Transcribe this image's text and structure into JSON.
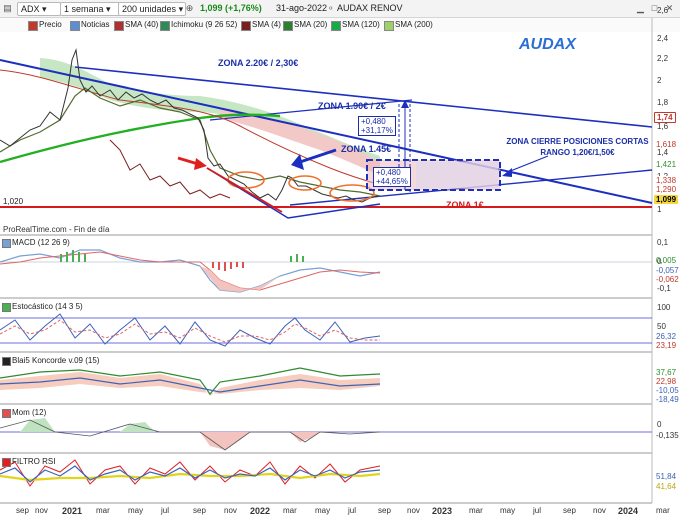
{
  "toolbar": {
    "symbol": "ADX",
    "timeframe": "1 semana",
    "units": "200 unidades",
    "price_change": "1,099 (+1,76%)",
    "date": "31-ago-2022",
    "instrument": "AUDAX RENOV"
  },
  "legend": {
    "items": [
      {
        "label": "Precio",
        "color": "#c0392b"
      },
      {
        "label": "Noticias",
        "color": "#5d8fd0"
      },
      {
        "label": "SMA (40)",
        "color": "#b03030"
      },
      {
        "label": "Ichimoku (9 26 52)",
        "color": "#2e8b57"
      },
      {
        "label": "SMA (4)",
        "color": "#7a1f1f"
      },
      {
        "label": "SMA (20)",
        "color": "#2f7d2f"
      },
      {
        "label": "SMA (120)",
        "color": "#1aa84b"
      },
      {
        "label": "SMA (200)",
        "color": "#9fd06a"
      }
    ]
  },
  "annotations": {
    "title": "AUDAX",
    "zona_220": "ZONA 2.20€ / 2,30€",
    "zona_190": "ZONA 1.90€ / 2€",
    "zona_145": "ZONA 1.45€",
    "zona_1": "ZONA 1€",
    "zona_cierre_1": "ZONA CIERRE POSICIONES CORTAS",
    "zona_cierre_2": "RANGO 1,20€/1,50€",
    "box1_a": "+0,480",
    "box1_b": "+31,17%",
    "box2_a": "+0,480",
    "box2_b": "+44,65%",
    "level_1020": "1,020",
    "source": "ProRealTime.com - Fin de día"
  },
  "price_axis": {
    "ticks": [
      "2,6",
      "2,4",
      "2,2",
      "2",
      "1,8",
      "1,6",
      "1,4",
      "1,2",
      "1"
    ],
    "tags": [
      {
        "text": "1,74",
        "bg": "#fff",
        "fg": "#c0392b"
      },
      {
        "text": "1,618",
        "bg": "#fff",
        "fg": "#c0392b"
      },
      {
        "text": "1,421",
        "bg": "#fff",
        "fg": "#2f8f2f"
      },
      {
        "text": "1,338",
        "bg": "#fff",
        "fg": "#c0392b"
      },
      {
        "text": "1,290",
        "bg": "#fff",
        "fg": "#c0392b"
      },
      {
        "text": "1,099",
        "bg": "#f5d742",
        "fg": "#000"
      }
    ]
  },
  "panels": {
    "macd": {
      "label": "MACD (12 26 9)",
      "ticks": [
        "0,1",
        "0",
        "-0,1"
      ],
      "tags": [
        "0,005",
        "-0,057",
        "-0,062"
      ]
    },
    "estocastico": {
      "label": "Estocástico (14 3 5)",
      "ticks": [
        "100",
        "50"
      ],
      "tags": [
        "26,32",
        "23,19"
      ]
    },
    "koncorde": {
      "label": "Blai5 Koncorde v.09 (15)",
      "tags": [
        "37,67",
        "22,98",
        "-10,05",
        "-18,49"
      ]
    },
    "mom": {
      "label": "Mom (12)",
      "ticks": [
        "0"
      ],
      "tags": [
        "-0,135"
      ]
    },
    "filtro": {
      "label": "FILTRO RSI",
      "tags": [
        "51,84",
        "41,64"
      ]
    }
  },
  "time_axis": {
    "labels": [
      {
        "text": "sep",
        "year": false
      },
      {
        "text": "nov",
        "year": false
      },
      {
        "text": "2021",
        "year": true
      },
      {
        "text": "mar",
        "year": false
      },
      {
        "text": "may",
        "year": false
      },
      {
        "text": "jul",
        "year": false
      },
      {
        "text": "sep",
        "year": false
      },
      {
        "text": "nov",
        "year": false
      },
      {
        "text": "2022",
        "year": true
      },
      {
        "text": "mar",
        "year": false
      },
      {
        "text": "may",
        "year": false
      },
      {
        "text": "jul",
        "year": false
      },
      {
        "text": "sep",
        "year": false
      },
      {
        "text": "nov",
        "year": false
      },
      {
        "text": "2023",
        "year": true
      },
      {
        "text": "mar",
        "year": false
      },
      {
        "text": "may",
        "year": false
      },
      {
        "text": "jul",
        "year": false
      },
      {
        "text": "sep",
        "year": false
      },
      {
        "text": "nov",
        "year": false
      },
      {
        "text": "2024",
        "year": true
      },
      {
        "text": "mar",
        "year": false
      }
    ]
  },
  "icons": [
    "chart-icon",
    "dropdown-icon",
    "add-indicator-icon",
    "minimize-icon",
    "maximize-icon",
    "close-icon"
  ]
}
